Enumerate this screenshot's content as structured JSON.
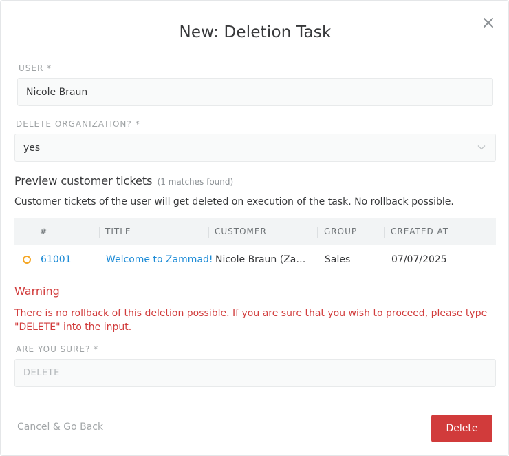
{
  "dialog": {
    "title": "New: Deletion Task",
    "close_icon": "close-icon"
  },
  "form": {
    "user_label": "USER *",
    "user_value": "Nicole Braun",
    "delete_org_label": "DELETE ORGANIZATION? *",
    "delete_org_value": "yes",
    "are_you_sure_label": "ARE YOU SURE? *",
    "are_you_sure_placeholder": "DELETE"
  },
  "preview": {
    "heading": "Preview customer tickets",
    "matches": "(1 matches found)",
    "description": "Customer tickets of the user will get deleted on execution of the task. No rollback possible.",
    "columns": [
      "#",
      "TITLE",
      "CUSTOMER",
      "GROUP",
      "CREATED AT"
    ],
    "rows": [
      {
        "number": "61001",
        "title": "Welcome to Zammad!",
        "customer": "Nicole Braun (Zammad Foundation)",
        "group": "Sales",
        "created_at": "07/07/2025",
        "status_color": "#f5a623"
      }
    ]
  },
  "warning": {
    "title": "Warning",
    "text": "There is no rollback of this deletion possible. If you are sure that you wish to proceed, please type \"DELETE\" into the input."
  },
  "actions": {
    "cancel_label": "Cancel & Go Back",
    "delete_label": "Delete"
  },
  "colors": {
    "danger": "#d13b3b",
    "link": "#1d8bd6",
    "status_open": "#f5a623"
  }
}
